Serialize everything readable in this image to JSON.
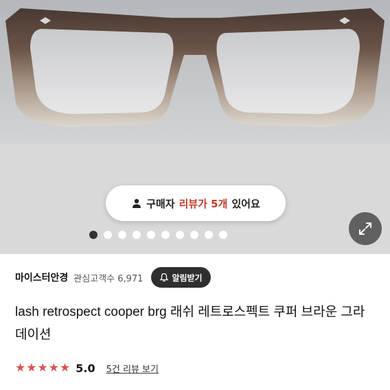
{
  "gallery": {
    "review_pill": {
      "prefix": "구매자",
      "highlight": "리뷰가 5개",
      "suffix": "있어요"
    },
    "slide_count": 10,
    "active_slide": 1
  },
  "seller": {
    "shop_name": "마이스터안경",
    "followers_label": "관심고객수 6,971",
    "notify_label": "알림받기"
  },
  "product": {
    "title": "lash retrospect cooper brg 래쉬 레트로스펙트 쿠퍼 브라운 그라데이션"
  },
  "rating": {
    "stars": 5,
    "score": "5.0",
    "review_link": "5건 리뷰 보기"
  },
  "colors": {
    "accent": "#c0392b",
    "star": "#d9534f",
    "dark_button": "#2f2f2f"
  }
}
